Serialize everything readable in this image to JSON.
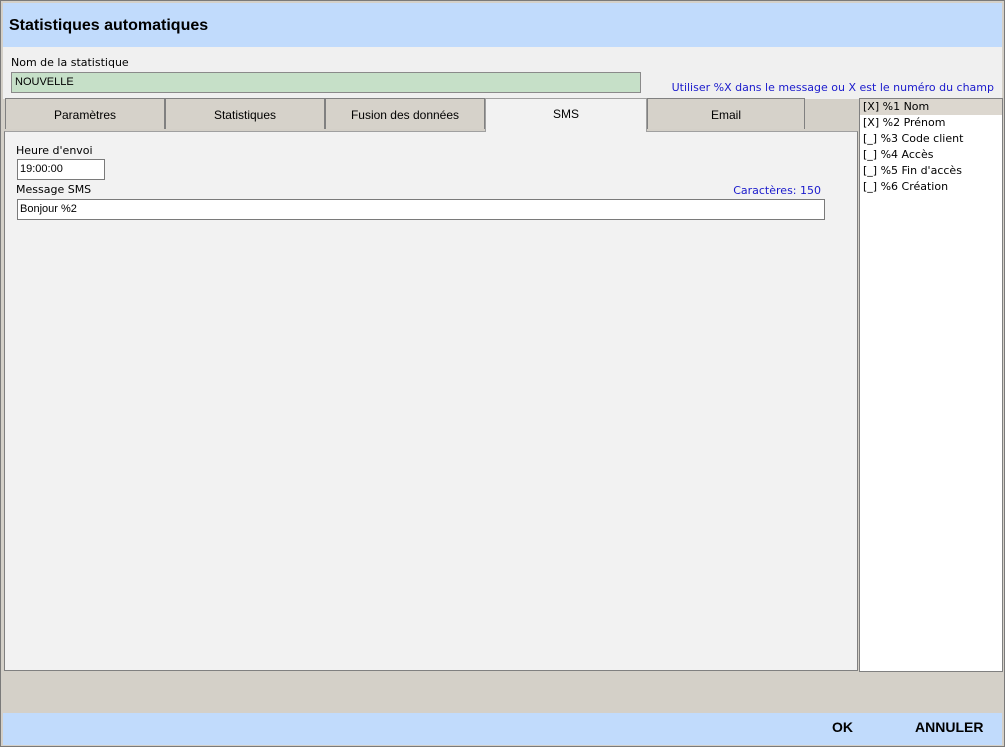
{
  "window": {
    "title": "Statistiques automatiques"
  },
  "name_field": {
    "label": "Nom de la statistique",
    "value": "NOUVELLE"
  },
  "hint": "Utiliser %X dans le message ou X est le numéro du champ",
  "tabs": [
    {
      "label": "Paramètres"
    },
    {
      "label": "Statistiques"
    },
    {
      "label": "Fusion des données"
    },
    {
      "label": "SMS"
    },
    {
      "label": "Email"
    }
  ],
  "active_tab": "SMS",
  "sms": {
    "time_label": "Heure d'envoi",
    "time_value": "19:00:00",
    "message_label": "Message SMS",
    "char_count": "Caractères: 150",
    "message_value": "Bonjour %2"
  },
  "fields": [
    {
      "label": "[X] %1 Nom",
      "checked": true
    },
    {
      "label": "[X] %2 Prénom",
      "checked": true
    },
    {
      "label": "[_] %3 Code client",
      "checked": false
    },
    {
      "label": "[_] %4 Accès",
      "checked": false
    },
    {
      "label": "[_] %5 Fin d'accès",
      "checked": false
    },
    {
      "label": "[_] %6 Création",
      "checked": false
    }
  ],
  "footer": {
    "ok_label": "OK",
    "cancel_label": "ANNULER"
  },
  "colors": {
    "title_bar": "#c1dbfc",
    "name_field_bg": "#c6e0c8",
    "hint_text": "#1a1acc",
    "panel_bg": "#f2f2f2",
    "chrome": "#d4d0c8"
  }
}
